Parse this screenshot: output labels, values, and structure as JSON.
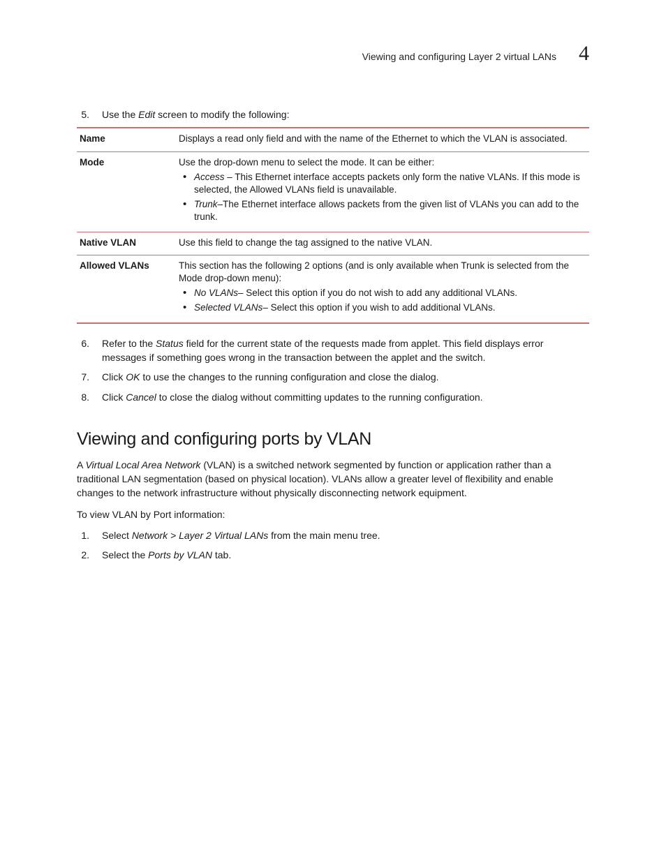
{
  "header": {
    "running_title": "Viewing and configuring Layer 2 virtual LANs",
    "chapter_number": "4"
  },
  "step5": {
    "num": "5.",
    "prefix": "Use the ",
    "italic": "Edit",
    "suffix": " screen to modify the following:"
  },
  "table": {
    "rows": [
      {
        "term": "Name",
        "desc": "Displays a read only field and with the name of the Ethernet to which the VLAN is associated.",
        "bullets": []
      },
      {
        "term": "Mode",
        "desc": "Use the drop-down menu to select the mode. It can be either:",
        "bullets": [
          {
            "italic": "Access",
            "sep": " – ",
            "text": "This Ethernet interface accepts packets only form the native VLANs. If this mode is selected, the Allowed VLANs field is unavailable."
          },
          {
            "italic": "Trunk",
            "sep": "–",
            "text": "The Ethernet interface allows packets from the given list of VLANs you can add to the trunk."
          }
        ]
      },
      {
        "term": "Native VLAN",
        "desc": "Use this field to change the tag assigned to the native VLAN.",
        "bullets": []
      },
      {
        "term": "Allowed VLANs",
        "desc": "This section has the following 2 options (and is only available when Trunk is selected from the Mode drop-down menu):",
        "bullets": [
          {
            "italic": "No VLANs",
            "sep": "– ",
            "text": "Select this option if you do not wish to add any additional VLANs."
          },
          {
            "italic": "Selected VLANs",
            "sep": "– ",
            "text": "Select this option if you wish to add additional VLANs."
          }
        ]
      }
    ]
  },
  "step6": {
    "num": "6.",
    "prefix": "Refer to the ",
    "italic": "Status",
    "suffix": " field for the current state of the requests made from applet. This field displays error messages if something goes wrong in the transaction between the applet and the switch."
  },
  "step7": {
    "num": "7.",
    "prefix": "Click ",
    "italic": "OK",
    "suffix": " to use the changes to the running configuration and close the dialog."
  },
  "step8": {
    "num": "8.",
    "prefix": "Click ",
    "italic": "Cancel",
    "suffix": " to close the dialog without committing updates to the running configuration."
  },
  "section": {
    "title": "Viewing and configuring ports by VLAN",
    "intro_pre": "A ",
    "intro_italic": "Virtual Local Area Network",
    "intro_post": " (VLAN) is a switched network segmented by function or application rather than a traditional LAN segmentation (based on physical location). VLANs allow a greater level of flexibility and enable changes to the network infrastructure without physically disconnecting network equipment.",
    "lead": "To view VLAN by Port information:",
    "step1": {
      "num": "1.",
      "prefix": "Select ",
      "italic": "Network > Layer 2 Virtual LANs",
      "suffix": " from the main menu tree."
    },
    "step2": {
      "num": "2.",
      "prefix": "Select the ",
      "italic": "Ports by VLAN",
      "suffix": " tab."
    }
  }
}
